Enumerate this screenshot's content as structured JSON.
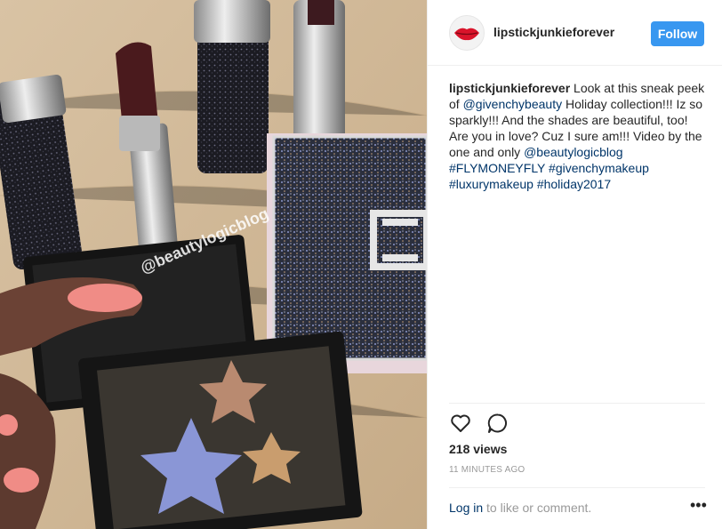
{
  "post": {
    "username": "lipstickjunkieforever",
    "follow_label": "Follow",
    "watermark": "@beautylogicblog",
    "caption": {
      "username": "lipstickjunkieforever",
      "t1": " Look at this sneak peek of ",
      "mention1": "@givenchybeauty",
      "t2": " Holiday collection!!! Iz so sparkly!!! And the shades are beautiful, too! Are you in love? Cuz I sure am!!! Video by the one and only ",
      "mention2": "@beautylogicblog",
      "tag1": "#FLYMONEYFLY",
      "tag2": "#givenchymakeup",
      "tag3": "#luxurymakeup",
      "tag4": "#holiday2017"
    },
    "views": "218 views",
    "time": "11 MINUTES AGO",
    "login_link": "Log in",
    "login_rest": " to like or comment.",
    "more_label": "•••"
  },
  "icons": {
    "like": "heart-icon",
    "comment": "comment-icon",
    "more": "more-options-icon"
  },
  "colors": {
    "follow_bg": "#3897f0",
    "link": "#003569",
    "muted": "#999999"
  }
}
